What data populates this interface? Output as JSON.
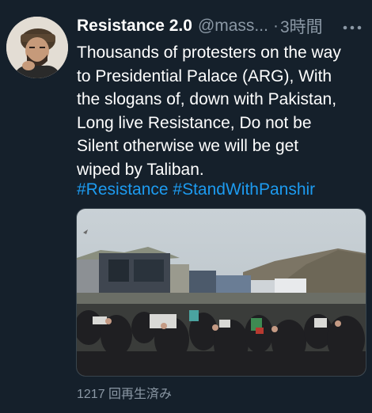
{
  "tweet": {
    "author_name": "Resistance 2.0",
    "handle": "@mass...",
    "separator": "·",
    "time": "3時間",
    "more_icon": "more-options-icon",
    "body": "Thousands of protesters on the way\nto Presidential Palace (ARG), With\nthe slogans of, down with Pakistan,\nLong live Resistance, Do not be\nSilent otherwise we will be get\nwiped by Taliban.",
    "hashtags": [
      "#Resistance",
      "#StandWithPanshir"
    ],
    "views": "1217 回再生済み",
    "colors": {
      "background": "#15202b",
      "link": "#1d9bf0",
      "secondary_text": "#8b98a5"
    }
  }
}
